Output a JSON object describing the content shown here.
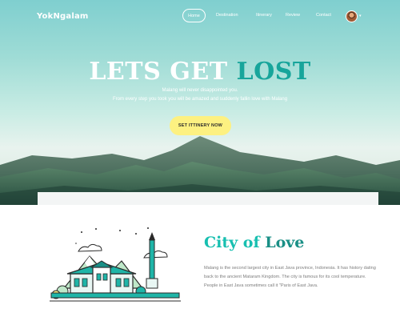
{
  "brand": {
    "name": "YokNgalam"
  },
  "nav": {
    "items": [
      "Home",
      "Destination",
      "Itinerary",
      "Review",
      "Contact"
    ],
    "active": "Home"
  },
  "hero": {
    "headline_white": "LETS GET ",
    "headline_accent": "LOST",
    "subtitle_line1": "Malang will never disappointed you.",
    "subtitle_line2": "From every step you took you will be amazed and suddenly fallin love with Malang",
    "cta_label": "Set Ittinery now"
  },
  "about": {
    "title_first": "City of ",
    "title_second": "Love",
    "description": "Malang is the second largest city in East Java province, Indonesia. It has history dating back to the ancient Mataram Kingdom. The city is famous for its cool temperature. People in East Java sometimes call it \"Paris of East Java."
  },
  "colors": {
    "accent_teal": "#17a59b",
    "cta_yellow": "#fdf181",
    "hero_sky": "#9fdcd6"
  },
  "icons": [
    "avatar",
    "chevron-down-icon",
    "city-illustration"
  ]
}
